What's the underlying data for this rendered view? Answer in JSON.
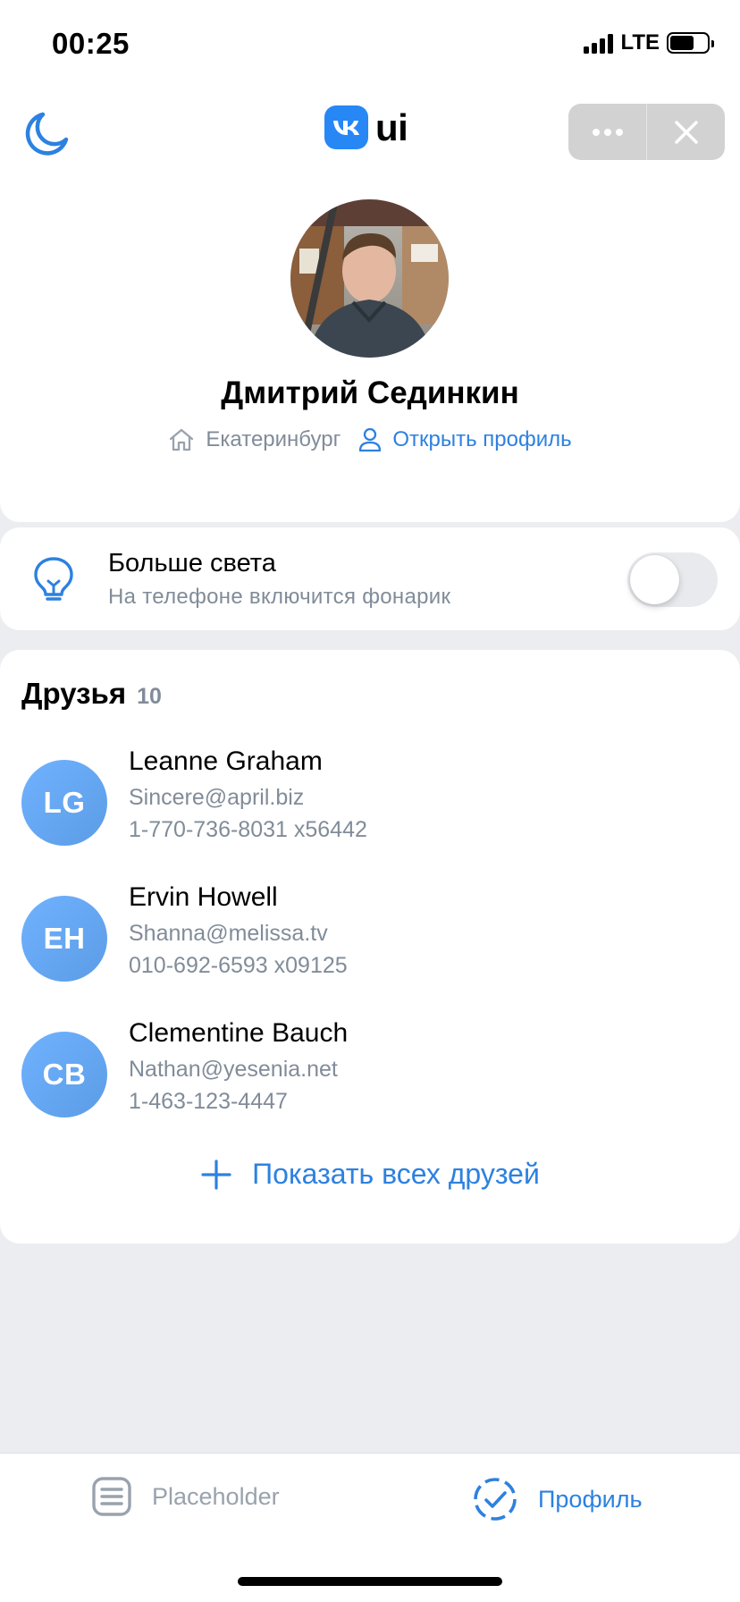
{
  "status_bar": {
    "time": "00:25",
    "network": "LTE",
    "icons": [
      "signal-icon",
      "battery-icon"
    ]
  },
  "header": {
    "logo_text": "ui",
    "icons": [
      "moon-icon",
      "vk-logo-icon",
      "more-icon",
      "close-icon"
    ]
  },
  "profile": {
    "name": "Дмитрий Сединкин",
    "city": "Екатеринбург",
    "open_profile_label": "Открыть профиль",
    "icons": [
      "home-icon",
      "user-icon"
    ]
  },
  "flashlight": {
    "title": "Больше света",
    "subtitle": "На телефоне включится фонарик",
    "enabled": false,
    "icon": "lightbulb-icon"
  },
  "friends": {
    "title": "Друзья",
    "count": "10",
    "items": [
      {
        "initials": "LG",
        "name": "Leanne Graham",
        "email": "Sincere@april.biz",
        "phone": "1-770-736-8031 x56442"
      },
      {
        "initials": "EH",
        "name": "Ervin Howell",
        "email": "Shanna@melissa.tv",
        "phone": "010-692-6593 x09125"
      },
      {
        "initials": "CB",
        "name": "Clementine Bauch",
        "email": "Nathan@yesenia.net",
        "phone": "1-463-123-4447"
      }
    ],
    "show_all_label": "Показать всех друзей"
  },
  "tabbar": {
    "tabs": [
      {
        "label": "Placeholder",
        "icon": "document-icon",
        "active": false
      },
      {
        "label": "Профиль",
        "icon": "check-circle-icon",
        "active": true
      }
    ]
  },
  "colors": {
    "accent": "#2d81e0",
    "secondary_text": "#818c99",
    "background": "#ebedf0",
    "avatar_gradient": [
      "#70b2ff",
      "#5c9ce6"
    ]
  }
}
